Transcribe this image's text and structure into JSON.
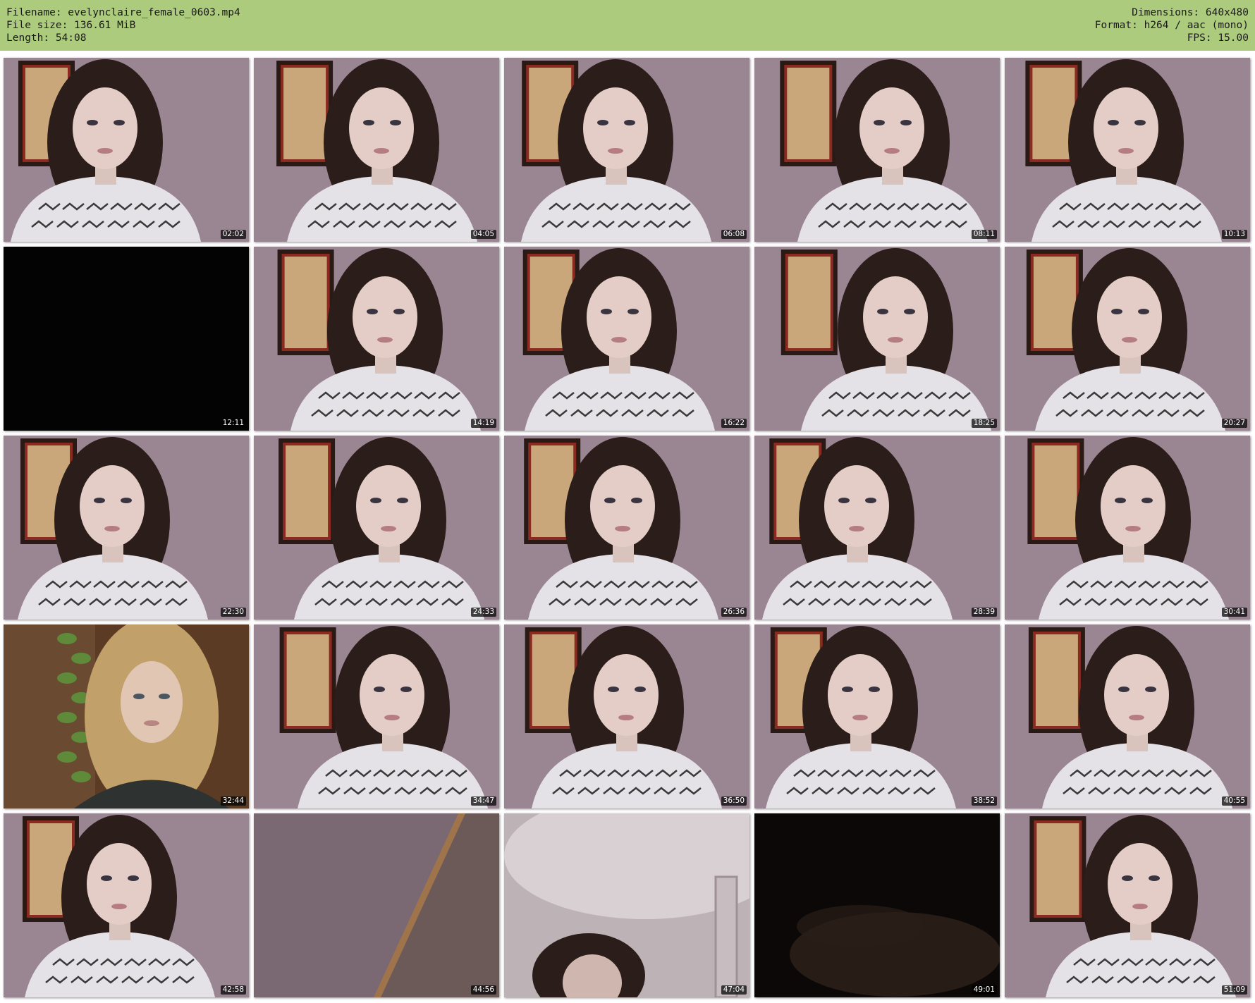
{
  "header": {
    "filename_line": "Filename: evelynclaire_female_0603.mp4",
    "filesize_line": "File size: 136.61 MiB",
    "length_line": "Length: 54:08",
    "dimensions_line": "Dimensions: 640x480",
    "format_line": "Format: h264 / aac (mono)",
    "fps_line": "FPS: 15.00",
    "background_color": "#adcb7c"
  },
  "thumbnails": [
    {
      "time": "02:02",
      "scene": "room"
    },
    {
      "time": "04:05",
      "scene": "room"
    },
    {
      "time": "06:08",
      "scene": "room"
    },
    {
      "time": "08:11",
      "scene": "room"
    },
    {
      "time": "10:13",
      "scene": "room"
    },
    {
      "time": "12:11",
      "scene": "black"
    },
    {
      "time": "14:19",
      "scene": "room"
    },
    {
      "time": "16:22",
      "scene": "room"
    },
    {
      "time": "18:25",
      "scene": "room"
    },
    {
      "time": "20:27",
      "scene": "room"
    },
    {
      "time": "22:30",
      "scene": "room"
    },
    {
      "time": "24:33",
      "scene": "room"
    },
    {
      "time": "26:36",
      "scene": "room"
    },
    {
      "time": "28:39",
      "scene": "room"
    },
    {
      "time": "30:41",
      "scene": "room"
    },
    {
      "time": "32:44",
      "scene": "photo"
    },
    {
      "time": "34:47",
      "scene": "room"
    },
    {
      "time": "36:50",
      "scene": "room"
    },
    {
      "time": "38:52",
      "scene": "room"
    },
    {
      "time": "40:55",
      "scene": "room"
    },
    {
      "time": "42:58",
      "scene": "room"
    },
    {
      "time": "44:56",
      "scene": "corner"
    },
    {
      "time": "47:04",
      "scene": "ceiling"
    },
    {
      "time": "49:01",
      "scene": "dark"
    },
    {
      "time": "51:09",
      "scene": "room"
    }
  ]
}
